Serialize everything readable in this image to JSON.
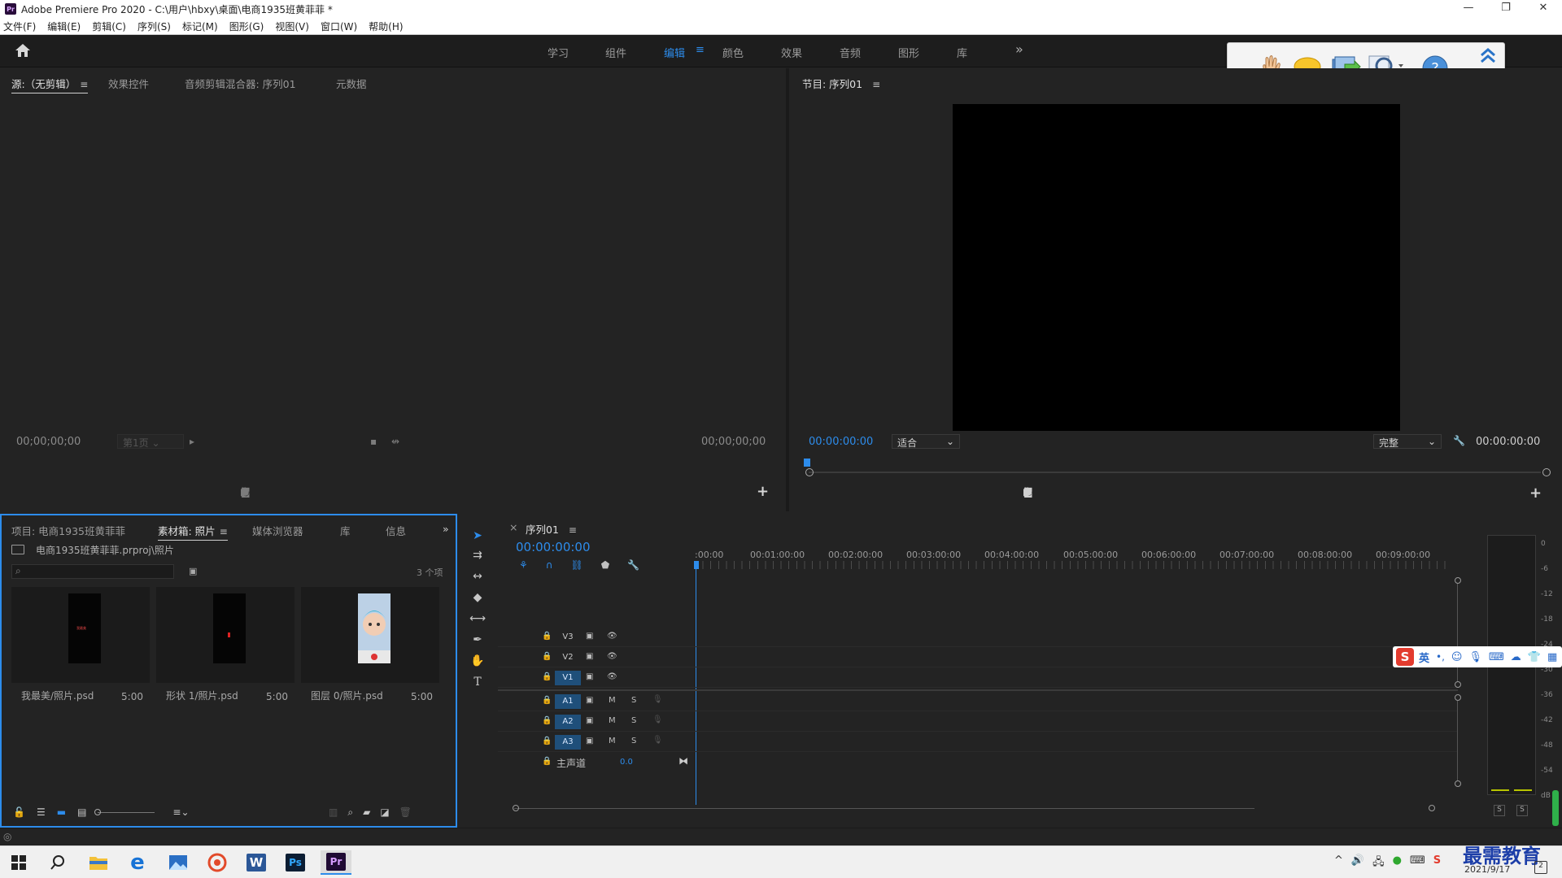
{
  "window": {
    "title": "Adobe Premiere Pro 2020 - C:\\用户\\hbxy\\桌面\\电商1935班黄菲菲 *",
    "logo": "Pr",
    "minimize": "—",
    "maximize": "❐",
    "close": "✕"
  },
  "menu": [
    "文件(F)",
    "编辑(E)",
    "剪辑(C)",
    "序列(S)",
    "标记(M)",
    "图形(G)",
    "视图(V)",
    "窗口(W)",
    "帮助(H)"
  ],
  "workspaces": {
    "items": [
      "学习",
      "组件",
      "编辑",
      "颜色",
      "效果",
      "音频",
      "图形",
      "库"
    ],
    "active": "编辑",
    "menu_icon": "≡",
    "more": "»"
  },
  "source_panel": {
    "tabs": [
      "源:（无剪辑）",
      "效果控件",
      "音频剪辑混合器: 序列01",
      "元数据"
    ],
    "menu_icon": "≡",
    "timecode_left": "00;00;00;00",
    "page_select": "第1页",
    "timecode_right": "00;00;00;00",
    "add": "+"
  },
  "program_panel": {
    "title": "节目: 序列01",
    "menu_icon": "≡",
    "timecode": "00:00:00:00",
    "fit_select": "适合",
    "quality_select": "完整",
    "duration": "00:00:00:00",
    "add": "+"
  },
  "project_panel": {
    "tabs": [
      "项目: 电商1935班黄菲菲",
      "素材箱: 照片",
      "媒体浏览器",
      "库",
      "信息"
    ],
    "menu_icon": "≡",
    "more": "»",
    "path": "电商1935班黄菲菲.prproj\\照片",
    "item_count": "3 个项",
    "items": [
      {
        "name": "我最美/照片.psd",
        "duration": "5:00",
        "thumb_text": "我最美"
      },
      {
        "name": "形状 1/照片.psd",
        "duration": "5:00"
      },
      {
        "name": "图层 0/照片.psd",
        "duration": "5:00"
      }
    ]
  },
  "timeline": {
    "tab": "序列01",
    "close": "×",
    "menu_icon": "≡",
    "timecode": "00:00:00:00",
    "ruler": [
      ":00:00",
      "00:01:00:00",
      "00:02:00:00",
      "00:03:00:00",
      "00:04:00:00",
      "00:05:00:00",
      "00:06:00:00",
      "00:07:00:00",
      "00:08:00:00",
      "00:09:00:00"
    ],
    "video_tracks": [
      "V3",
      "V2",
      "V1"
    ],
    "audio_tracks": [
      "A1",
      "A2",
      "A3"
    ],
    "mute": "M",
    "solo": "S",
    "master": "主声道",
    "master_value": "0.0"
  },
  "audio_meter": {
    "scale": [
      "0",
      "-6",
      "-12",
      "-18",
      "-24",
      "-30",
      "-36",
      "-42",
      "-48",
      "-54",
      "dB"
    ],
    "solo_left": "S",
    "solo_right": "S"
  },
  "ime_bar": {
    "lang": "英"
  },
  "taskbar": {
    "apps": [
      "start-icon",
      "search-icon",
      "file-explorer-icon",
      "edge-icon",
      "photos-icon",
      "app-icon",
      "word-icon",
      "photoshop-icon",
      "premiere-icon"
    ],
    "date": "2021/9/17",
    "watermark": "最需教育",
    "notification_count": "2"
  },
  "colors": {
    "accent": "#2d8ceb",
    "panel": "#232323",
    "background": "#1a1a1a"
  }
}
